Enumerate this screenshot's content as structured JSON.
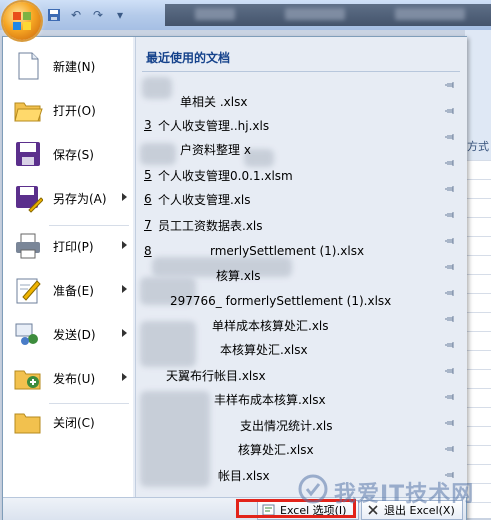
{
  "menu": {
    "items": [
      {
        "label": "新建(N)",
        "icon": "new-document-icon",
        "submenu": false
      },
      {
        "label": "打开(O)",
        "icon": "open-folder-icon",
        "submenu": false
      },
      {
        "label": "保存(S)",
        "icon": "save-icon",
        "submenu": false
      },
      {
        "label": "另存为(A)",
        "icon": "save-as-icon",
        "submenu": true
      },
      {
        "label": "打印(P)",
        "icon": "print-icon",
        "submenu": true
      },
      {
        "label": "准备(E)",
        "icon": "prepare-icon",
        "submenu": true
      },
      {
        "label": "发送(D)",
        "icon": "send-icon",
        "submenu": true
      },
      {
        "label": "发布(U)",
        "icon": "publish-icon",
        "submenu": true
      },
      {
        "label": "关闭(C)",
        "icon": "close-folder-icon",
        "submenu": false
      }
    ]
  },
  "recent": {
    "heading": "最近使用的文档",
    "documents": [
      {
        "num": "",
        "name": "单相关 .xlsx"
      },
      {
        "num": "3",
        "name": "个人收支管理..hj.xls"
      },
      {
        "num": "",
        "name": "户资料整理 x"
      },
      {
        "num": "5",
        "name": "个人收支管理0.0.1.xlsm"
      },
      {
        "num": "6",
        "name": "个人收支管理.xls"
      },
      {
        "num": "7",
        "name": "员工工资数据表.xls"
      },
      {
        "num": "8",
        "name": "rmerlySettlement (1).xlsx"
      },
      {
        "num": "",
        "name": "核算.xls"
      },
      {
        "num": "",
        "name": "297766_ formerlySettlement (1).xlsx"
      },
      {
        "num": "",
        "name": "单样成本核算处汇.xls"
      },
      {
        "num": "",
        "name": "本核算处汇.xlsx"
      },
      {
        "num": "",
        "name": "天翼布行帐目.xlsx"
      },
      {
        "num": "",
        "name": "丰样布成本核算.xlsx"
      },
      {
        "num": "",
        "name": "支出情况统计.xls"
      },
      {
        "num": "",
        "name": "核算处汇.xlsx"
      },
      {
        "num": "",
        "name": "帐目.xlsx"
      }
    ]
  },
  "bottom": {
    "options_label": "Excel 选项(I)",
    "exit_label": "退出 Excel(X)"
  },
  "background": {
    "ribbon_text": "方式"
  },
  "watermark": {
    "text": "我爱IT技术网"
  },
  "colors": {
    "accent": "#15428b",
    "highlight": "#e2231a",
    "office_button": "#f6a623"
  }
}
